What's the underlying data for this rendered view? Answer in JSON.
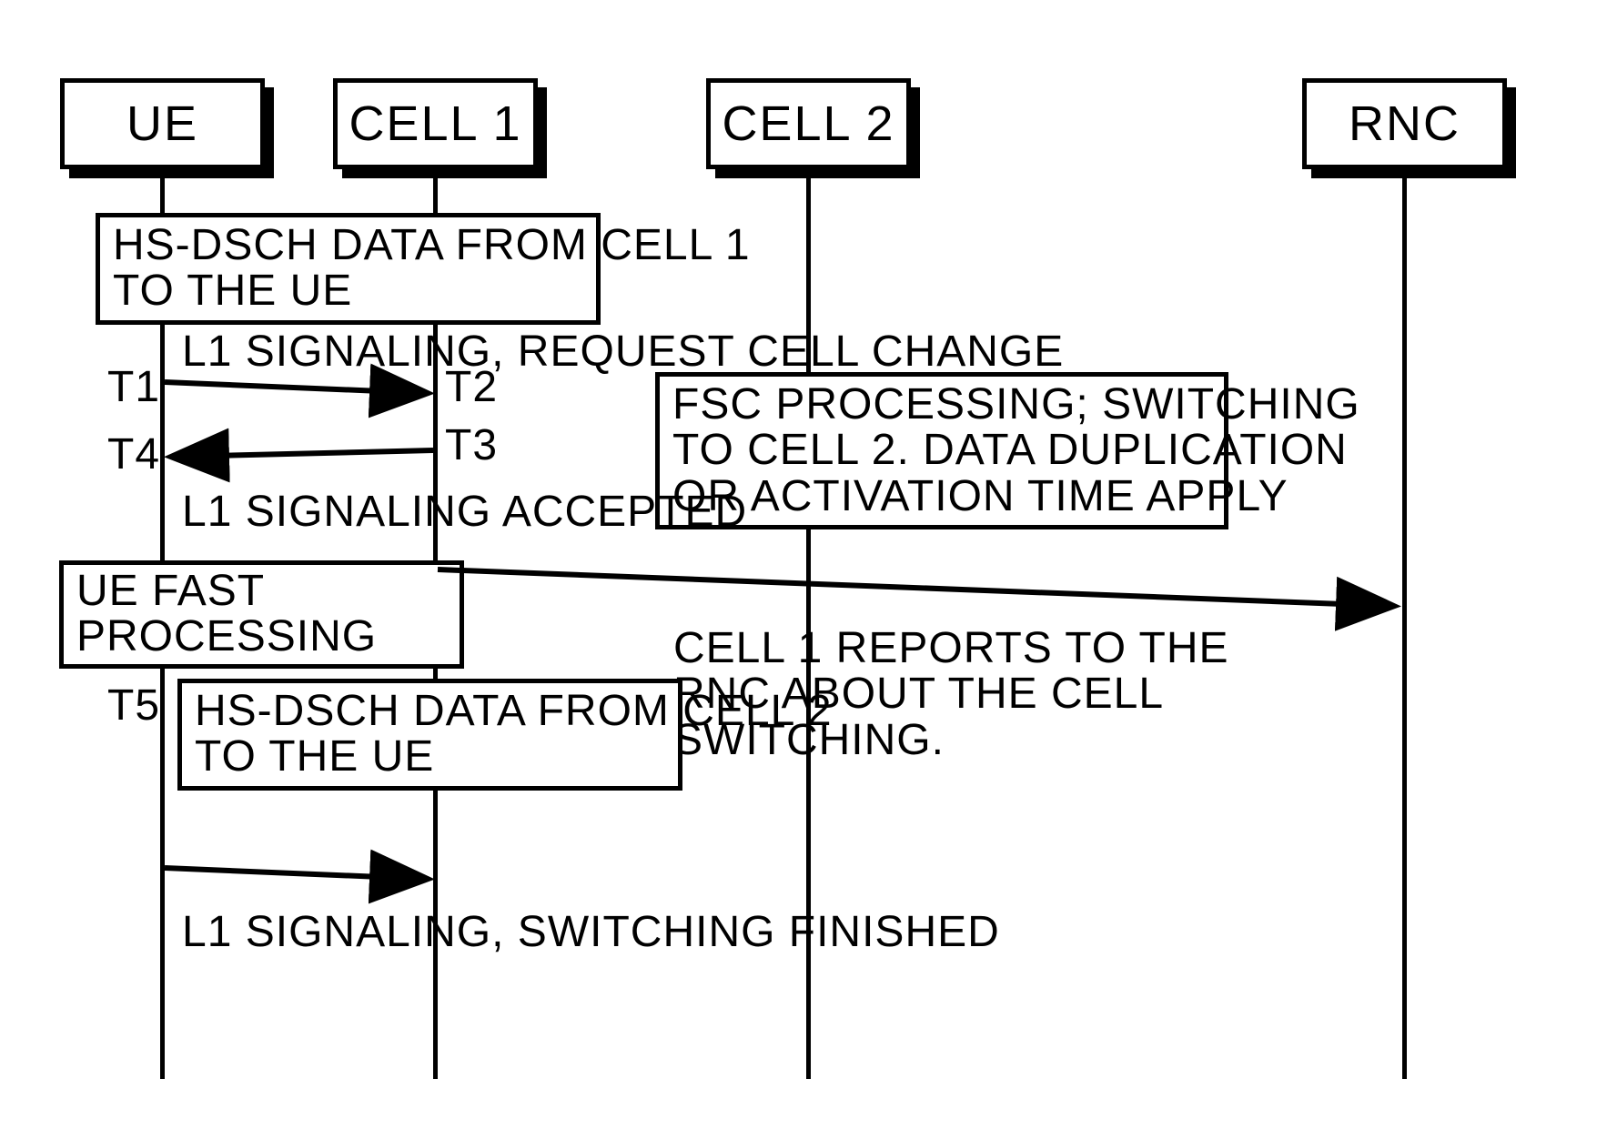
{
  "participants": {
    "ue": {
      "label": "UE"
    },
    "cell1": {
      "label": "CELL 1"
    },
    "cell2": {
      "label": "CELL 2"
    },
    "rnc": {
      "label": "RNC"
    }
  },
  "notes": {
    "hs_from_cell1": "HS-DSCH DATA FROM CELL 1\nTO THE UE",
    "fsc": "FSC PROCESSING; SWITCHING\nTO CELL 2. DATA DUPLICATION\nOR ACTIVATION TIME APPLY",
    "ue_fast": "UE FAST PROCESSING",
    "hs_from_cell2": "HS-DSCH DATA FROM CELL 2\nTO THE UE",
    "cell1_reports": "CELL 1 REPORTS TO THE\nRNC ABOUT THE CELL\nSWITCHING."
  },
  "messages": {
    "m1_label": "L1 SIGNALING, REQUEST CELL CHANGE",
    "m2_label": "L1 SIGNALING ACCEPTED",
    "m3_label": "L1 SIGNALING, SWITCHING FINISHED"
  },
  "time_marks": {
    "t1": "T1",
    "t2": "T2",
    "t3": "T3",
    "t4": "T4",
    "t5": "T5"
  }
}
